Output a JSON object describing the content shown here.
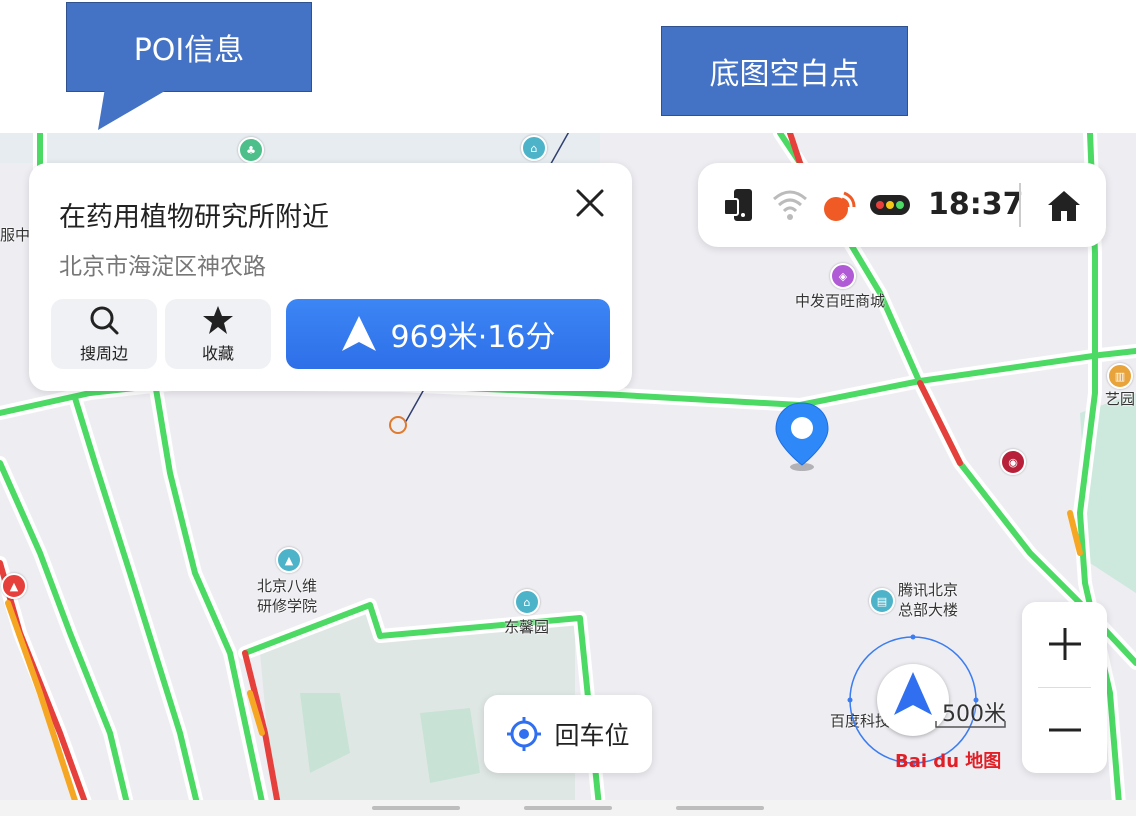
{
  "annotations": {
    "poi_callout": "POI信息",
    "blank_callout": "底图空白点"
  },
  "poi_card": {
    "title": "在药用植物研究所附近",
    "address": "北京市海淀区神农路",
    "search_nearby_label": "搜周边",
    "favorite_label": "收藏",
    "navigate_label": "969米·16分",
    "icons": [
      "close-icon",
      "search-icon",
      "star-icon",
      "navigate-arrow-icon"
    ]
  },
  "status_bar": {
    "time": "18:37",
    "icons": [
      "phone-connected-icon",
      "wifi-icon",
      "gps-signal-icon",
      "traffic-light-icon",
      "home-icon"
    ]
  },
  "map": {
    "labels": {
      "zhongfa": "中发百旺商城",
      "bajiwei": "北京八维\n研修学院",
      "bajiwei_line1": "北京八维",
      "bajiwei_line2": "研修学院",
      "dongxin": "东馨园",
      "tencent_line1": "腾讯北京",
      "tencent_line2": "总部大楼",
      "baidu_tech": "百度科技",
      "yiyuan": "艺园",
      "fu_zhong": "服中"
    },
    "scale": "500米",
    "logo": "Bai du 地图",
    "colors": {
      "road_smooth": "#4cd964",
      "road_slow": "#f5a623",
      "road_jam": "#e5403b",
      "park": "#cde8dd",
      "background": "#eeedf2",
      "accent": "#3478f6"
    }
  },
  "controls": {
    "recenter_label": "回车位",
    "zoom_in": "+",
    "zoom_out": "−"
  }
}
